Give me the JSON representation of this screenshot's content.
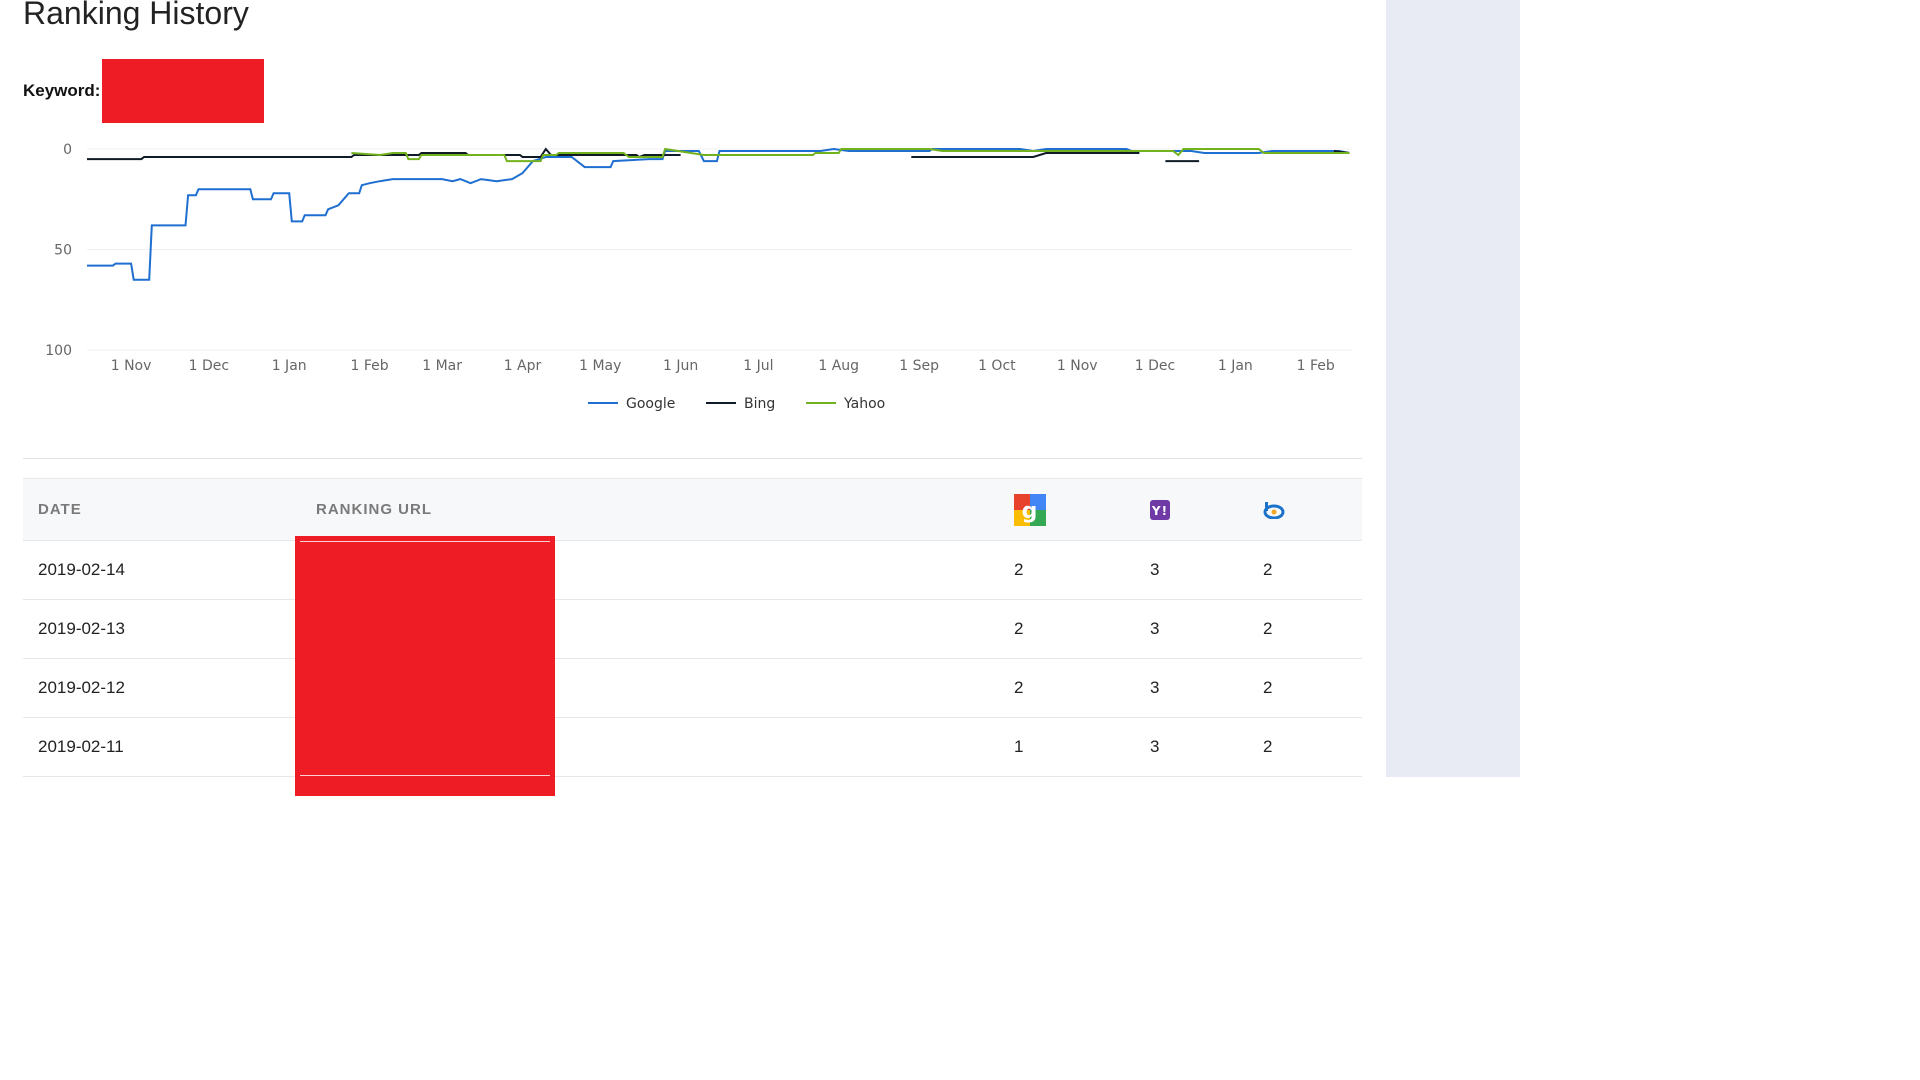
{
  "page": {
    "title": "Ranking History"
  },
  "keyword": {
    "label": "Keyword:"
  },
  "colors": {
    "google": "#1f6fd0",
    "bing": "#111b27",
    "yahoo": "#73b21f",
    "redaction": "#ee1c25",
    "sidebar_bg": "#e8ebf3"
  },
  "chart_data": {
    "type": "line",
    "title": "",
    "xlabel": "",
    "ylabel": "",
    "ylim": [
      100,
      0
    ],
    "y_inverted": true,
    "yticks": [
      "0",
      "50",
      "100"
    ],
    "xticks": [
      "1 Nov",
      "1 Dec",
      "1 Jan",
      "1 Feb",
      "1 Mar",
      "1 Apr",
      "1 May",
      "1 Jun",
      "1 Jul",
      "1 Aug",
      "1 Sep",
      "1 Oct",
      "1 Nov",
      "1 Dec",
      "1 Jan",
      "1 Feb"
    ],
    "xtick_dates": [
      "2017-11-01",
      "2017-12-01",
      "2018-01-01",
      "2018-02-01",
      "2018-03-01",
      "2018-04-01",
      "2018-05-01",
      "2018-06-01",
      "2018-07-01",
      "2018-08-01",
      "2018-09-01",
      "2018-10-01",
      "2018-11-01",
      "2018-12-01",
      "2019-01-01",
      "2019-02-01"
    ],
    "legend_position": "bottom-center",
    "grid": true,
    "series": [
      {
        "name": "Google",
        "color": "#1f6fd0",
        "points": [
          [
            "2017-10-15",
            58
          ],
          [
            "2017-10-25",
            58
          ],
          [
            "2017-10-26",
            57
          ],
          [
            "2017-11-01",
            57
          ],
          [
            "2017-11-02",
            65
          ],
          [
            "2017-11-08",
            65
          ],
          [
            "2017-11-09",
            38
          ],
          [
            "2017-11-22",
            38
          ],
          [
            "2017-11-23",
            23
          ],
          [
            "2017-11-26",
            23
          ],
          [
            "2017-11-27",
            20
          ],
          [
            "2017-12-17",
            20
          ],
          [
            "2017-12-18",
            25
          ],
          [
            "2017-12-25",
            25
          ],
          [
            "2017-12-26",
            22
          ],
          [
            "2018-01-01",
            22
          ],
          [
            "2018-01-02",
            36
          ],
          [
            "2018-01-06",
            36
          ],
          [
            "2018-01-07",
            33
          ],
          [
            "2018-01-15",
            33
          ],
          [
            "2018-01-16",
            30
          ],
          [
            "2018-01-20",
            28
          ],
          [
            "2018-01-24",
            22
          ],
          [
            "2018-01-28",
            22
          ],
          [
            "2018-01-29",
            18
          ],
          [
            "2018-02-01",
            17
          ],
          [
            "2018-02-05",
            16
          ],
          [
            "2018-02-10",
            15
          ],
          [
            "2018-03-01",
            15
          ],
          [
            "2018-03-05",
            16
          ],
          [
            "2018-03-08",
            15
          ],
          [
            "2018-03-12",
            17
          ],
          [
            "2018-03-16",
            15
          ],
          [
            "2018-03-22",
            16
          ],
          [
            "2018-03-28",
            15
          ],
          [
            "2018-04-01",
            12
          ],
          [
            "2018-04-05",
            6
          ],
          [
            "2018-04-10",
            4
          ],
          [
            "2018-04-20",
            4
          ],
          [
            "2018-04-25",
            9
          ],
          [
            "2018-05-05",
            9
          ],
          [
            "2018-05-06",
            6
          ],
          [
            "2018-05-20",
            5
          ],
          [
            "2018-05-25",
            5
          ],
          [
            "2018-05-26",
            1
          ],
          [
            "2018-06-08",
            1
          ],
          [
            "2018-06-10",
            6
          ],
          [
            "2018-06-15",
            6
          ],
          [
            "2018-06-16",
            1
          ],
          [
            "2018-07-25",
            1
          ],
          [
            "2018-07-30",
            0
          ],
          [
            "2018-08-05",
            1
          ],
          [
            "2018-09-05",
            1
          ],
          [
            "2018-09-06",
            0
          ],
          [
            "2018-10-10",
            0
          ],
          [
            "2018-10-15",
            1
          ],
          [
            "2018-10-20",
            0
          ],
          [
            "2018-11-20",
            0
          ],
          [
            "2018-11-22",
            1
          ],
          [
            "2018-12-15",
            1
          ],
          [
            "2018-12-20",
            2
          ],
          [
            "2019-01-10",
            2
          ],
          [
            "2019-01-15",
            1
          ],
          [
            "2019-02-10",
            1
          ],
          [
            "2019-02-14",
            2
          ]
        ]
      },
      {
        "name": "Bing",
        "color": "#111b27",
        "points": [
          [
            "2017-10-15",
            5
          ],
          [
            "2017-11-05",
            5
          ],
          [
            "2017-11-06",
            4
          ],
          [
            "2018-01-25",
            4
          ],
          [
            "2018-01-26",
            3
          ],
          [
            "2018-02-20",
            3
          ],
          [
            "2018-02-21",
            2
          ],
          [
            "2018-03-10",
            2
          ],
          [
            "2018-03-11",
            3
          ],
          [
            "2018-03-31",
            3
          ],
          [
            "2018-04-01",
            4
          ],
          [
            "2018-04-08",
            4
          ],
          [
            "2018-04-10",
            0
          ],
          [
            "2018-04-12",
            3
          ],
          [
            "2018-05-15",
            3
          ],
          [
            "2018-05-16",
            4
          ],
          [
            "2018-05-18",
            3
          ],
          [
            "2018-06-01",
            3
          ]
        ],
        "extra_segments": [
          [
            [
              "2018-08-29",
              4
            ],
            [
              "2018-10-15",
              4
            ],
            [
              "2018-10-20",
              2
            ],
            [
              "2018-11-25",
              2
            ]
          ],
          [
            [
              "2018-11-30",
              1
            ],
            [
              "2018-12-02",
              1
            ]
          ],
          [
            [
              "2018-12-05",
              6
            ],
            [
              "2018-12-18",
              6
            ]
          ],
          [
            [
              "2019-02-08",
              1
            ],
            [
              "2019-02-14",
              2
            ]
          ]
        ]
      },
      {
        "name": "Yahoo",
        "color": "#73b21f",
        "points": [
          [
            "2018-01-25",
            2
          ],
          [
            "2018-02-05",
            3
          ],
          [
            "2018-02-10",
            2
          ],
          [
            "2018-02-15",
            2
          ],
          [
            "2018-02-16",
            5
          ],
          [
            "2018-02-20",
            5
          ],
          [
            "2018-02-21",
            3
          ],
          [
            "2018-03-10",
            3
          ],
          [
            "2018-03-15",
            3
          ],
          [
            "2018-03-25",
            3
          ],
          [
            "2018-03-26",
            6
          ],
          [
            "2018-04-08",
            6
          ],
          [
            "2018-04-09",
            3
          ],
          [
            "2018-04-14",
            3
          ],
          [
            "2018-04-15",
            2
          ],
          [
            "2018-05-10",
            2
          ],
          [
            "2018-05-12",
            4
          ],
          [
            "2018-05-25",
            4
          ],
          [
            "2018-05-26",
            0
          ],
          [
            "2018-06-05",
            2
          ],
          [
            "2018-06-10",
            3
          ],
          [
            "2018-07-22",
            3
          ],
          [
            "2018-07-23",
            2
          ],
          [
            "2018-08-01",
            2
          ],
          [
            "2018-08-02",
            0
          ],
          [
            "2018-09-05",
            0
          ],
          [
            "2018-09-10",
            1
          ],
          [
            "2018-11-01",
            1
          ],
          [
            "2018-12-08",
            1
          ],
          [
            "2018-12-10",
            3
          ],
          [
            "2018-12-12",
            0
          ],
          [
            "2019-01-10",
            0
          ],
          [
            "2019-01-12",
            2
          ],
          [
            "2019-02-14",
            2
          ]
        ]
      }
    ]
  },
  "table": {
    "headers": {
      "date": "DATE",
      "url": "RANKING URL"
    },
    "engine_icons": [
      "google-icon",
      "yahoo-icon",
      "bing-icon"
    ],
    "rows": [
      {
        "date": "2019-02-14",
        "google": "2",
        "yahoo": "3",
        "bing": "2"
      },
      {
        "date": "2019-02-13",
        "google": "2",
        "yahoo": "3",
        "bing": "2"
      },
      {
        "date": "2019-02-12",
        "google": "2",
        "yahoo": "3",
        "bing": "2"
      },
      {
        "date": "2019-02-11",
        "google": "1",
        "yahoo": "3",
        "bing": "2"
      }
    ]
  }
}
